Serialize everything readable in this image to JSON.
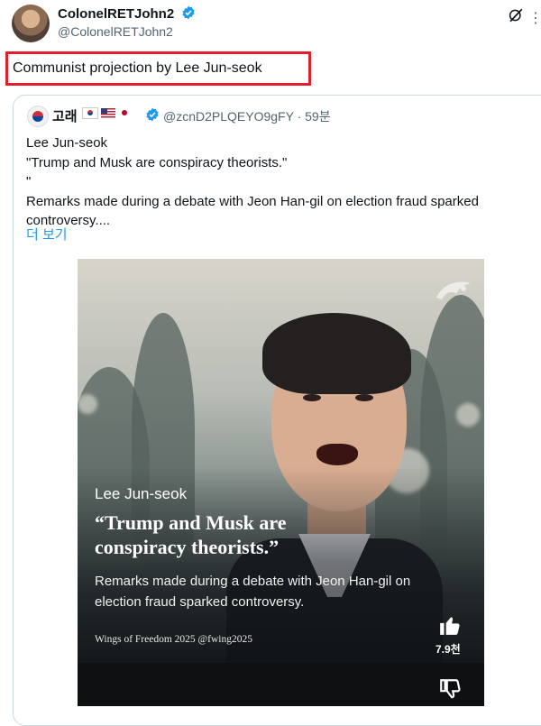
{
  "post": {
    "author_name": "ColonelRETJohn2",
    "author_handle": "@ColonelRETJohn2",
    "text": "Communist projection by Lee Jun-seok"
  },
  "quoted": {
    "name": "고래",
    "flags": [
      "kr-flag",
      "us-flag",
      "jp-flag"
    ],
    "handle": "@zcnD2PLQEYO9gFY · 59분",
    "lines": [
      "Lee Jun-seok",
      "\"Trump and Musk are conspiracy theorists.\"",
      "\"",
      "Remarks made during a debate with Jeon Han-gil on election fraud sparked",
      "controversy...."
    ],
    "show_more": "더 보기"
  },
  "media": {
    "name": "Lee Jun-seok",
    "quote": "“Trump and Musk are conspiracy theorists.”",
    "subtitle": "Remarks made during a debate with Jeon Han-gil on election fraud sparked controversy.",
    "credit": "Wings of Freedom 2025 @fwing2025",
    "like_count": "7.9천"
  },
  "colors": {
    "highlight_box": "#e0202c",
    "verified": "#1d9bf0",
    "link": "#1d9bf0"
  }
}
